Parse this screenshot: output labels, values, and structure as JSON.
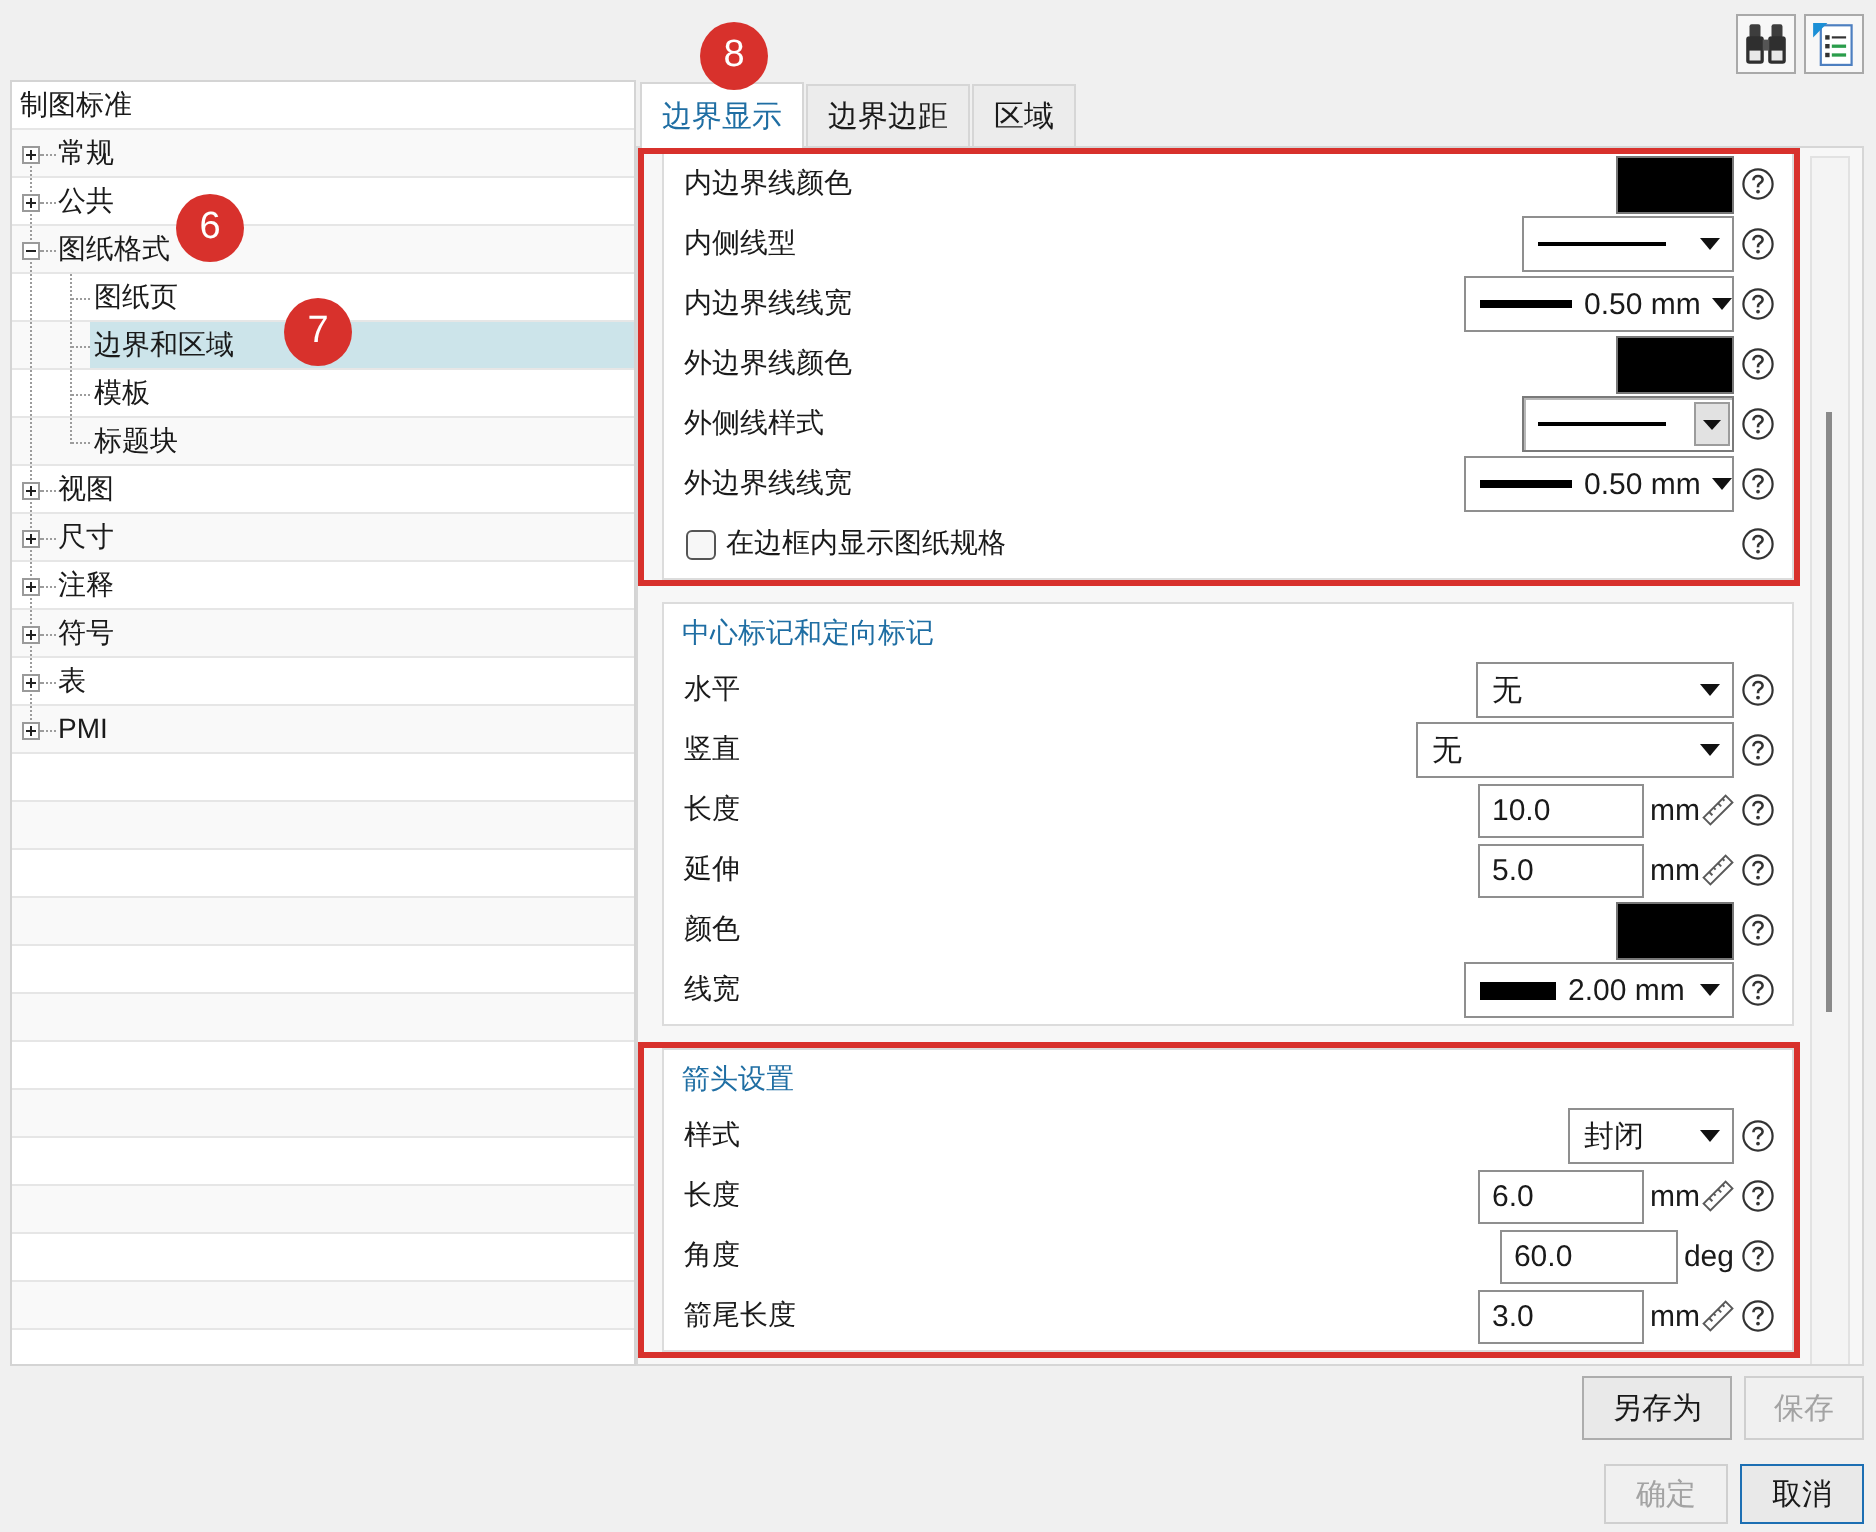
{
  "tree": {
    "header": "制图标准",
    "items": [
      {
        "label": "常规",
        "expanded": false,
        "selected": false
      },
      {
        "label": "公共",
        "expanded": false,
        "selected": false
      },
      {
        "label": "图纸格式",
        "expanded": true,
        "selected": false,
        "callout": "6",
        "children": [
          {
            "label": "图纸页",
            "selected": false
          },
          {
            "label": "边界和区域",
            "selected": true,
            "callout": "7"
          },
          {
            "label": "模板",
            "selected": false
          },
          {
            "label": "标题块",
            "selected": false
          }
        ]
      },
      {
        "label": "视图",
        "expanded": false,
        "selected": false
      },
      {
        "label": "尺寸",
        "expanded": false,
        "selected": false
      },
      {
        "label": "注释",
        "expanded": false,
        "selected": false
      },
      {
        "label": "符号",
        "expanded": false,
        "selected": false
      },
      {
        "label": "表",
        "expanded": false,
        "selected": false
      },
      {
        "label": "PMI",
        "expanded": false,
        "selected": false
      }
    ]
  },
  "tabs": [
    {
      "label": "边界显示",
      "selected": true,
      "callout": "8"
    },
    {
      "label": "边界边距",
      "selected": false
    },
    {
      "label": "区域",
      "selected": false
    }
  ],
  "sections": [
    {
      "highlighted": true,
      "rows": [
        {
          "kind": "color",
          "label": "内边界线颜色",
          "color": "#000000"
        },
        {
          "kind": "linetype",
          "label": "内侧线型",
          "focused": false
        },
        {
          "kind": "linewidth",
          "label": "内边界线线宽",
          "value": "0.50 mm",
          "heavy": false,
          "focused": false
        },
        {
          "kind": "color",
          "label": "外边界线颜色",
          "color": "#000000"
        },
        {
          "kind": "linetype",
          "label": "外侧线样式",
          "focused": true
        },
        {
          "kind": "linewidth",
          "label": "外边界线线宽",
          "value": "0.50 mm",
          "heavy": false,
          "focused": false
        },
        {
          "kind": "checkbox",
          "label": "在边框内显示图纸规格",
          "checked": false
        }
      ]
    },
    {
      "title": "中心标记和定向标记",
      "highlighted": false,
      "rows": [
        {
          "kind": "dropdown",
          "label": "水平",
          "value": "无",
          "focused": false
        },
        {
          "kind": "dropdown",
          "label": "竖直",
          "value": "无",
          "focused": false
        },
        {
          "kind": "number",
          "label": "长度",
          "value": "10.0",
          "unit": "mm",
          "ruler": true,
          "focused": false
        },
        {
          "kind": "number",
          "label": "延伸",
          "value": "5.0",
          "unit": "mm",
          "ruler": true,
          "focused": false
        },
        {
          "kind": "color",
          "label": "颜色",
          "color": "#000000"
        },
        {
          "kind": "linewidth",
          "label": "线宽",
          "value": "2.00 mm",
          "heavy": true,
          "focused": false
        }
      ]
    },
    {
      "title": "箭头设置",
      "highlighted": true,
      "rows": [
        {
          "kind": "dropdown",
          "label": "样式",
          "value": "封闭",
          "focused": false
        },
        {
          "kind": "number",
          "label": "长度",
          "value": "6.0",
          "unit": "mm",
          "ruler": true,
          "focused": false
        },
        {
          "kind": "number",
          "label": "角度",
          "value": "60.0",
          "unit": "deg",
          "ruler": false,
          "focused": false
        },
        {
          "kind": "number",
          "label": "箭尾长度",
          "value": "3.0",
          "unit": "mm",
          "ruler": true,
          "focused": false
        }
      ]
    }
  ],
  "button_rows": [
    [
      {
        "label": "另存为",
        "disabled": false,
        "default": false
      },
      {
        "label": "保存",
        "disabled": true,
        "default": false
      }
    ],
    [
      {
        "label": "确定",
        "disabled": true,
        "default": false
      },
      {
        "label": "取消",
        "disabled": false,
        "default": true
      }
    ]
  ]
}
